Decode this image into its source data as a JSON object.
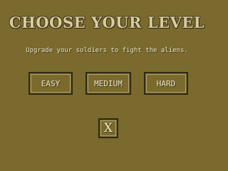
{
  "screen": {
    "title": "CHOOSE YOUR LEVEL",
    "subtitle": "Upgrade your soldiers to fight the aliens.",
    "buttons": {
      "easy": "EASY",
      "medium": "MEDIUM",
      "hard": "HARD",
      "close": "X"
    }
  },
  "colors": {
    "background": "#7a6a2e",
    "title_text": "#d8cba0",
    "button_border": "#2f2a14",
    "button_text": "#efe7c8"
  }
}
